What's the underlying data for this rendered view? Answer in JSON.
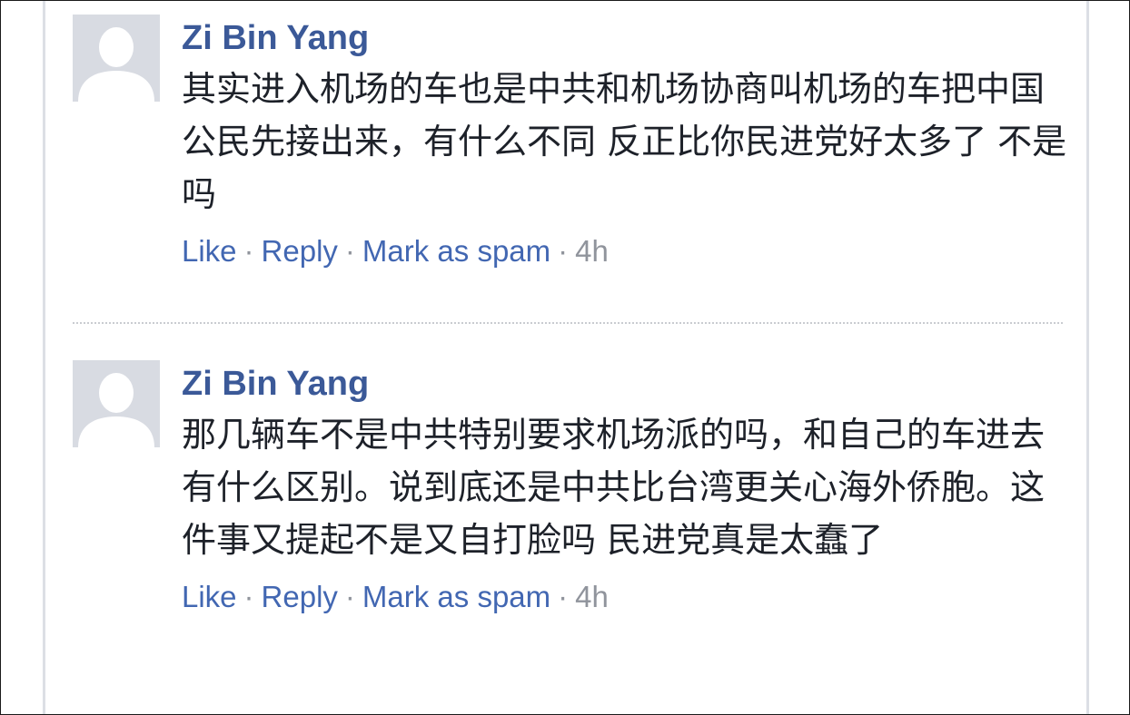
{
  "comments": [
    {
      "author": "Zi Bin Yang",
      "text": "其实进入机场的车也是中共和机场协商叫机场的车把中国公民先接出来，有什么不同 反正比你民进党好太多了 不是吗",
      "actions": {
        "like": "Like",
        "reply": "Reply",
        "spam": "Mark as spam",
        "separator": "·",
        "time": "4h"
      }
    },
    {
      "author": "Zi Bin Yang",
      "text": "那几辆车不是中共特别要求机场派的吗，和自己的车进去有什么区别。说到底还是中共比台湾更关心海外侨胞。这件事又提起不是又自打脸吗 民进党真是太蠢了",
      "actions": {
        "like": "Like",
        "reply": "Reply",
        "spam": "Mark as spam",
        "separator": "·",
        "time": "4h"
      }
    }
  ],
  "colors": {
    "author": "#3b5998",
    "link": "#4267b2",
    "meta": "#90949c",
    "text": "#1d2129",
    "avatar_bg": "#d8dbe2",
    "avatar_silhouette": "#ffffff"
  },
  "icons": {
    "avatar": "default-profile-silhouette-icon"
  }
}
